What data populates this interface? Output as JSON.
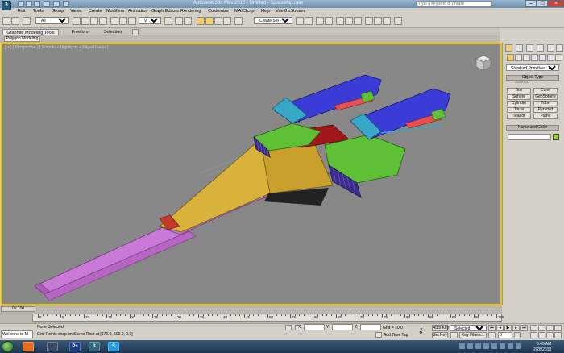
{
  "app": {
    "title": "Autodesk 3ds Max 2010 - Untitled - Spaceship.max",
    "logo": "3ds-max-logo"
  },
  "search": {
    "placeholder": "Type a keyword or phrase"
  },
  "menu": [
    "Edit",
    "Tools",
    "Group",
    "Views",
    "Create",
    "Modifiers",
    "Animation",
    "Graph Editors",
    "Rendering",
    "Customize",
    "MAXScript",
    "Help",
    "Vue 8 xStream"
  ],
  "toolbar": {
    "selection_filter": "All",
    "ref_coord": "View",
    "selection_set": "Create Selection Se"
  },
  "ribbon": {
    "tabs": [
      "Graphite Modeling Tools",
      "Freeform",
      "Selection"
    ],
    "panel_button": "Polygon Modeling"
  },
  "viewport": {
    "label": "[ + ] [ Perspective ] [ Smooth + Highlights + Edged Faces ]"
  },
  "command_panel": {
    "dropdown": "Standard Primitives",
    "object_type_header": "Object Type",
    "autogrid": "AutoGrid",
    "buttons": [
      "Box",
      "Cone",
      "Sphere",
      "GeoSphere",
      "Cylinder",
      "Tube",
      "Torus",
      "Pyramid",
      "Teapot",
      "Plane"
    ],
    "name_color_header": "Name and Color",
    "object_color": "#9acd32"
  },
  "timeline": {
    "slider": "0 / 100",
    "tick_labels": [
      "0",
      "5",
      "10",
      "15",
      "20",
      "25",
      "30",
      "35",
      "40",
      "45",
      "50",
      "55",
      "60",
      "65",
      "70",
      "75",
      "80",
      "85",
      "90",
      "95",
      "100"
    ]
  },
  "status": {
    "maxscript": "Welcome to M",
    "selection": "None Selected",
    "prompt": "Grid Points snap on Scene Root at [176.0, 500.0, 0.0]",
    "x_label": "X:",
    "y_label": "Y:",
    "z_label": "Z:",
    "grid": "Grid = 10.0",
    "add_time_tag": "Add Time Tag",
    "auto_key": "Auto Key",
    "set_key": "Set Key",
    "key_mode": "Selected",
    "key_filters": "Key Filters...",
    "frame": "0"
  },
  "taskbar": {
    "time": "9:49 AM",
    "date": "2/28/2010"
  }
}
